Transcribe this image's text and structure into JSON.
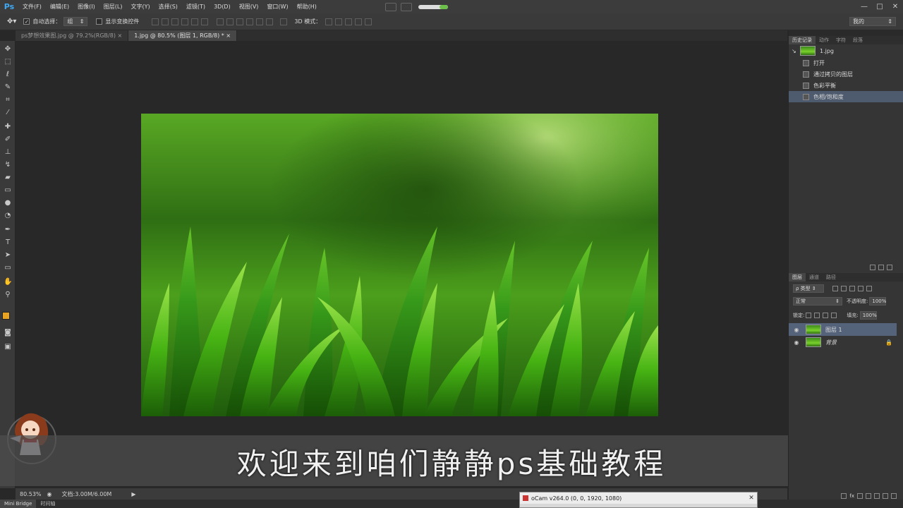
{
  "app": {
    "logo": "Ps"
  },
  "menu": [
    "文件(F)",
    "编辑(E)",
    "图像(I)",
    "图层(L)",
    "文字(Y)",
    "选择(S)",
    "滤镜(T)",
    "3D(D)",
    "视图(V)",
    "窗口(W)",
    "帮助(H)"
  ],
  "window_controls": {
    "minimize": "—",
    "maximize": "□",
    "close": "✕"
  },
  "options": {
    "auto_select_label": "自动选择：",
    "auto_select_value": "组",
    "show_transform_label": "显示变换控件",
    "mode_3d_label": "3D 模式：",
    "workspace": "我的"
  },
  "tabs": [
    {
      "label": "ps梦想效果图.jpg @ 79.2%(RGB/8)",
      "close": "×"
    },
    {
      "label": "1.jpg @ 80.5% (图层 1, RGB/8) *",
      "close": "×"
    }
  ],
  "history_panel": {
    "tabs": [
      "历史记录",
      "动作",
      "字符",
      "段落"
    ],
    "snapshot": "1.jpg",
    "items": [
      "打开",
      "通过拷贝的图层",
      "色彩平衡",
      "色相/饱和度"
    ]
  },
  "layers_panel": {
    "tabs": [
      "图层",
      "通道",
      "路径"
    ],
    "filter_label": "ρ 类型",
    "blend_mode": "正常",
    "opacity_label": "不透明度:",
    "opacity_value": "100%",
    "lock_label": "锁定:",
    "fill_label": "填充:",
    "fill_value": "100%",
    "layers": [
      {
        "name": "图层 1",
        "selected": true
      },
      {
        "name": "背景",
        "selected": false
      }
    ]
  },
  "caption": "欢迎来到咱们静静ps基础教程",
  "status": {
    "zoom": "80.53%",
    "doc": "文档:3.00M/6.00M"
  },
  "bottom_tabs": [
    "Mini Bridge",
    "时间轴"
  ],
  "ocam": {
    "title": "oCam v264.0 (0, 0, 1920, 1080)",
    "close": "✕"
  },
  "colors": {
    "foreground": "#e8a323",
    "background": "#ffffff",
    "accent": "#3fa9f5"
  }
}
